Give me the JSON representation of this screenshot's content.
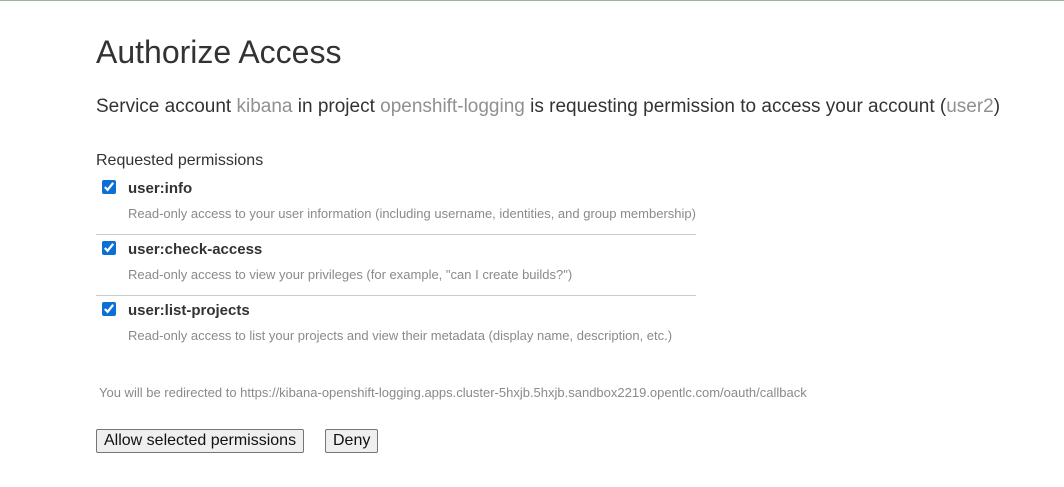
{
  "page": {
    "title": "Authorize Access"
  },
  "intro": {
    "prefix": "Service account ",
    "account": "kibana",
    "mid1": " in project ",
    "project": "openshift-logging",
    "mid2": " is requesting permission to access your account (",
    "user": "user2",
    "suffix": ")"
  },
  "permissions": {
    "heading": "Requested permissions",
    "items": [
      {
        "name": "user:info",
        "description": "Read-only access to your user information (including username, identities, and group membership)",
        "checked": true
      },
      {
        "name": "user:check-access",
        "description": "Read-only access to view your privileges (for example, \"can I create builds?\")",
        "checked": true
      },
      {
        "name": "user:list-projects",
        "description": "Read-only access to list your projects and view their metadata (display name, description, etc.)",
        "checked": true
      }
    ]
  },
  "redirect": {
    "text": "You will be redirected to https://kibana-openshift-logging.apps.cluster-5hxjb.5hxjb.sandbox2219.opentlc.com/oauth/callback"
  },
  "actions": {
    "allow_label": "Allow selected permissions",
    "deny_label": "Deny"
  },
  "colors": {
    "muted_text": "#909090",
    "checkbox_accent": "#0b6fd6"
  }
}
